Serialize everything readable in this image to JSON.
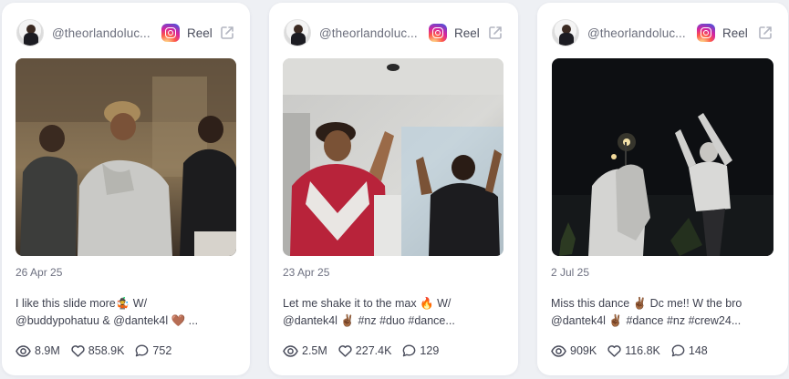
{
  "posts": [
    {
      "handle": "@theorlandoluc...",
      "type_label": "Reel",
      "platform_icon": "instagram-icon",
      "date": "26 Apr 25",
      "caption_line1": "I like this slide more🤹 W/",
      "caption_line2": "@buddypohatuu & @dantek4l 🤎 ...",
      "views": "8.9M",
      "likes": "858.9K",
      "comments": "752"
    },
    {
      "handle": "@theorlandoluc...",
      "type_label": "Reel",
      "platform_icon": "instagram-icon",
      "date": "23 Apr 25",
      "caption_line1": "Let me shake it to the max 🔥 W/",
      "caption_line2": "@dantek4l ✌🏾 #nz #duo #dance...",
      "views": "2.5M",
      "likes": "227.4K",
      "comments": "129"
    },
    {
      "handle": "@theorlandoluc...",
      "type_label": "Reel",
      "platform_icon": "instagram-icon",
      "date": "2 Jul 25",
      "caption_line1": "Miss this dance ✌🏾 Dc me!! W the bro",
      "caption_line2": "@dantek4l ✌🏾 #dance #nz #crew24...",
      "views": "909K",
      "likes": "116.8K",
      "comments": "148"
    }
  ],
  "colors": {
    "page_background": "#eef0f4",
    "card_background": "#ffffff",
    "text": "#3f4250",
    "muted": "#6d7080"
  }
}
